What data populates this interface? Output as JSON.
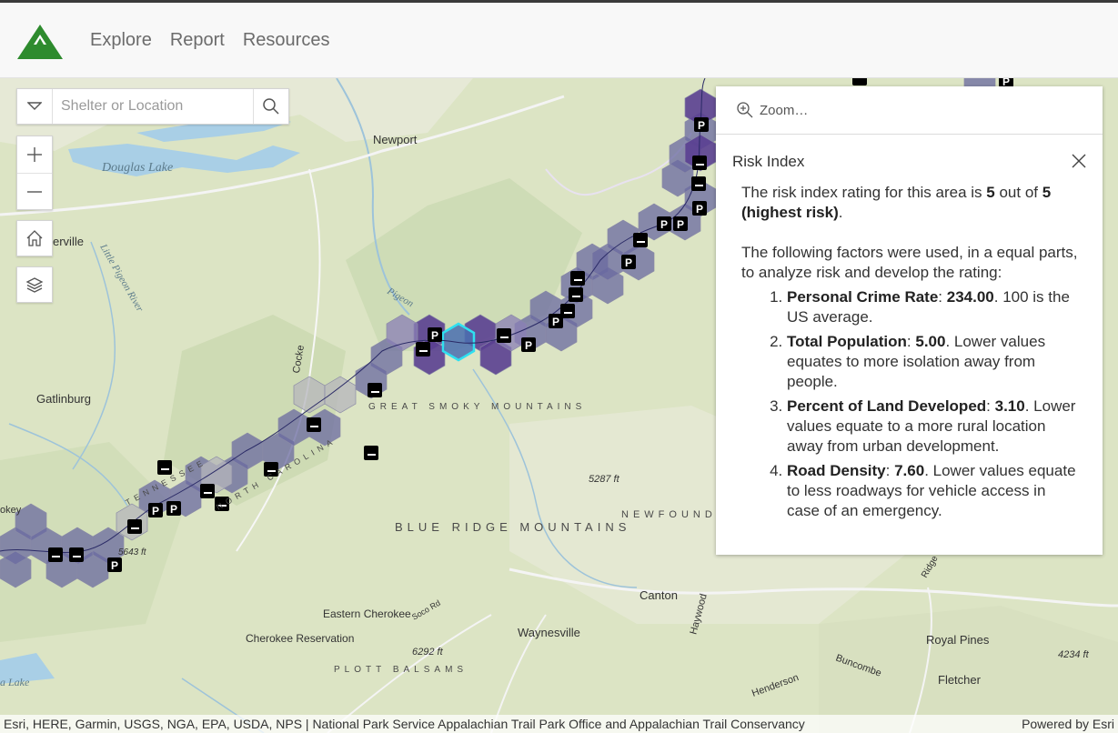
{
  "app": {
    "nav": [
      "Explore",
      "Report",
      "Resources"
    ],
    "brand_color": "#2e8b2e"
  },
  "search": {
    "placeholder": "Shelter or Location"
  },
  "popup": {
    "zoom_label": "Zoom…",
    "title": "Risk Index",
    "intro_a": "The risk index rating for this area is ",
    "rating": "5",
    "intro_b": " out of ",
    "max": "5 (highest risk)",
    "intro_c": ".",
    "factors_intro": "The following factors were used, in a equal parts, to analyze risk and develop the rating:",
    "factors": [
      {
        "name": "Personal Crime Rate",
        "value": "234.00",
        "note": ". 100 is the US average."
      },
      {
        "name": "Total Population",
        "value": "5.00",
        "note": ". Lower values equates to more isolation away from people."
      },
      {
        "name": "Percent of Land Developed",
        "value": "3.10",
        "note": ". Lower values equate to a more rural location away from urban development."
      },
      {
        "name": "Road Density",
        "value": "7.60",
        "note": ". Lower values equate to less roadways for vehicle access in case of an emergency."
      }
    ]
  },
  "map": {
    "labels": {
      "douglas_lake": "Douglas Lake",
      "newport": "Newport",
      "erville": "erville",
      "gatlinburg": "Gatlinburg",
      "great_smoky": "GREAT SMOKY MOUNTAINS",
      "blue_ridge": "BLUE RIDGE MOUNTAINS",
      "canton": "Canton",
      "waynesville": "Waynesville",
      "eastern_cherokee": "Eastern Cherokee",
      "cherokee_res": "Cherokee Reservation",
      "royal_pines": "Royal Pines",
      "fletcher": "Fletcher",
      "plott_balsams": "PLOTT BALSAMS",
      "elev_5287": "5287 ft",
      "elev_6292": "6292 ft",
      "elev_4234": "4234 ft",
      "elev_5643": "5643 ft",
      "newfound": "NEWFOUND",
      "cocke": "Cocke",
      "haywood": "Haywood",
      "buncombe": "Buncombe",
      "henderson": "Henderson",
      "little_pigeon": "Little Pigeon River",
      "pigeon": "Pigeon",
      "tennessee": "TENNESSEE",
      "north_carolina": "NORTH CAROLINA",
      "soco_rd": "Soco Rd",
      "lake": "a Lake",
      "okey": "okey",
      "ridge": "Ridge"
    }
  },
  "attribution": {
    "sources": "Esri, HERE, Garmin, USGS, NGA, EPA, USDA, NPS | National Park Service Appalachian Trail Park Office and Appalachian Trail Conservancy",
    "powered": "Powered by Esri"
  }
}
